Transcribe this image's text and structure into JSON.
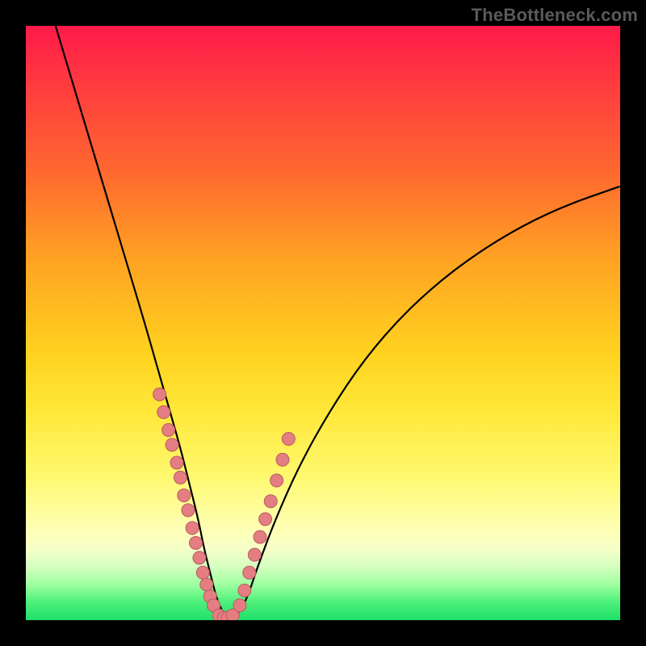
{
  "watermark": "TheBottleneck.com",
  "chart_data": {
    "type": "line",
    "title": "",
    "xlabel": "",
    "ylabel": "",
    "xlim": [
      0,
      100
    ],
    "ylim": [
      0,
      100
    ],
    "curve": {
      "x": [
        5,
        8,
        11,
        14,
        17,
        20,
        22,
        24,
        26,
        27.5,
        29,
        30,
        31,
        32,
        33,
        34,
        35,
        37,
        39,
        42,
        46,
        51,
        57,
        64,
        72,
        81,
        90,
        100
      ],
      "y": [
        100,
        90,
        80,
        70,
        60,
        50,
        43,
        36,
        29,
        23,
        17,
        12,
        8,
        4,
        1.5,
        0.3,
        0.3,
        3,
        9,
        17,
        26,
        35,
        44,
        52,
        59,
        65,
        69.5,
        73
      ]
    },
    "series": [
      {
        "name": "markers-left",
        "x": [
          22.5,
          23.2,
          24.0,
          24.6,
          25.4,
          26.0,
          26.6,
          27.3,
          28.0,
          28.6,
          29.2,
          29.8,
          30.4,
          31.0,
          31.6
        ],
        "y": [
          38.0,
          35.0,
          32.0,
          29.5,
          26.5,
          24.0,
          21.0,
          18.5,
          15.5,
          13.0,
          10.5,
          8.0,
          6.0,
          4.0,
          2.5
        ]
      },
      {
        "name": "markers-bottom",
        "x": [
          32.5,
          33.3,
          34.0,
          34.8
        ],
        "y": [
          0.8,
          0.4,
          0.4,
          0.8
        ]
      },
      {
        "name": "markers-right",
        "x": [
          36.0,
          36.8,
          37.6,
          38.5,
          39.4,
          40.3,
          41.2,
          42.2,
          43.2,
          44.2
        ],
        "y": [
          2.5,
          5.0,
          8.0,
          11.0,
          14.0,
          17.0,
          20.0,
          23.5,
          27.0,
          30.5
        ]
      }
    ]
  }
}
